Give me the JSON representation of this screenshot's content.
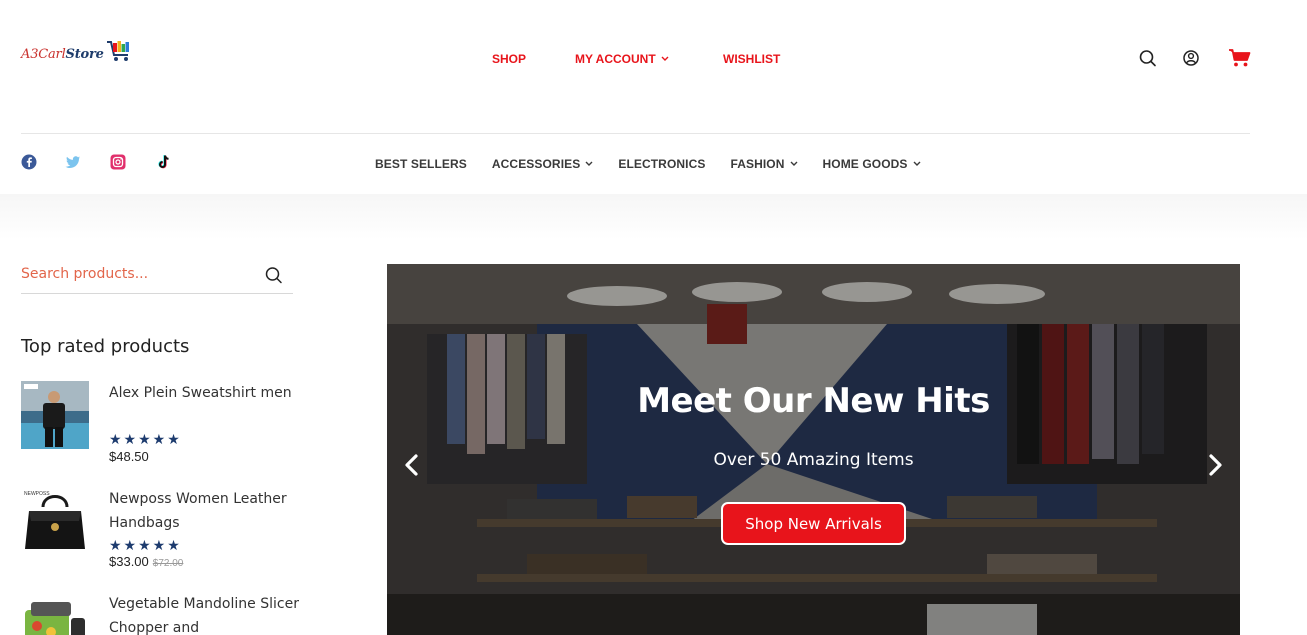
{
  "brand": {
    "logo_text_a": "A3Carl",
    "logo_text_b": "Store"
  },
  "main_nav": [
    {
      "label": "SHOP",
      "has_dropdown": false
    },
    {
      "label": "MY ACCOUNT",
      "has_dropdown": true
    },
    {
      "label": "WISHLIST",
      "has_dropdown": false
    }
  ],
  "header_icons": [
    "search-icon",
    "account-icon",
    "cart-icon"
  ],
  "social_icons": [
    "facebook-icon",
    "twitter-icon",
    "instagram-icon",
    "tiktok-icon"
  ],
  "category_nav": [
    {
      "label": "BEST SELLERS",
      "has_dropdown": false
    },
    {
      "label": "ACCESSORIES",
      "has_dropdown": true
    },
    {
      "label": "ELECTRONICS",
      "has_dropdown": false
    },
    {
      "label": "FASHION",
      "has_dropdown": true
    },
    {
      "label": "HOME GOODS",
      "has_dropdown": true
    }
  ],
  "sidebar": {
    "search_placeholder": "Search products...",
    "top_rated_title": "Top rated products",
    "products": [
      {
        "title": "Alex Plein Sweatshirt men",
        "stars": "★★★★★",
        "rating": 5,
        "price": "$48.50",
        "old_price": ""
      },
      {
        "title": "Newposs Women Leather Handbags",
        "stars": "★★★★★",
        "rating": 5,
        "price": "$33.00",
        "old_price": "$72.00"
      },
      {
        "title": "Vegetable Mandoline Slicer Chopper and",
        "stars": "",
        "rating": null,
        "price": "",
        "old_price": ""
      }
    ]
  },
  "hero": {
    "headline": "Meet Our New Hits",
    "subline": "Over 50 Amazing Items",
    "cta_label": "Shop New Arrivals"
  },
  "colors": {
    "accent_red": "#e8141b",
    "nav_dark": "#3a3a3a",
    "star_navy": "#1d3b6e"
  }
}
